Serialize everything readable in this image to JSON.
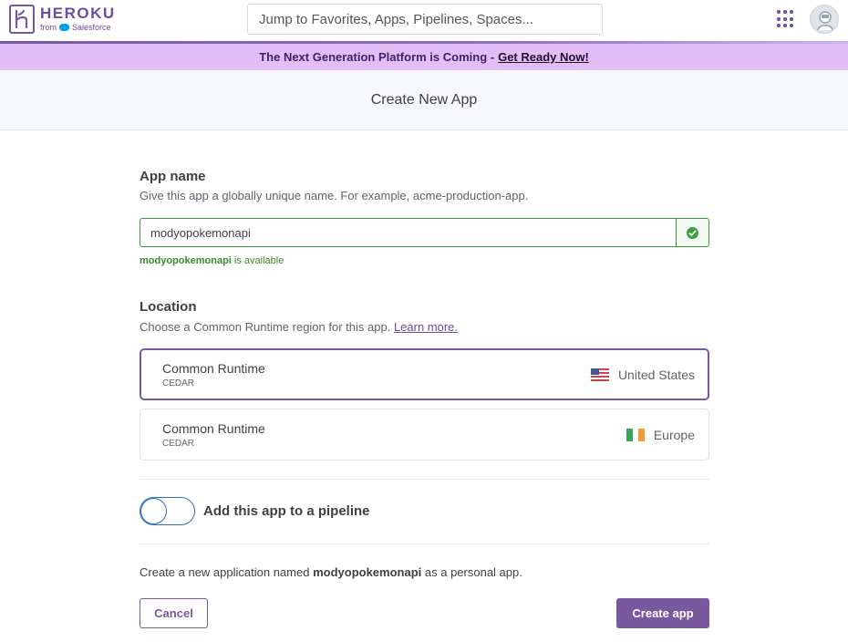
{
  "header": {
    "logo_text": "HEROKU",
    "logo_from": "from",
    "logo_salesforce": "Salesforce",
    "search_placeholder": "Jump to Favorites, Apps, Pipelines, Spaces..."
  },
  "banner": {
    "text": "The Next Generation Platform is Coming -",
    "link": "Get Ready Now!"
  },
  "page_title": "Create New App",
  "app_name": {
    "label": "App name",
    "hint": "Give this app a globally unique name. For example, acme-production-app.",
    "value": "modyopokemonapi",
    "available_name": "modyopokemonapi",
    "available_suffix": "is available"
  },
  "location": {
    "label": "Location",
    "hint": "Choose a Common Runtime region for this app.",
    "learn_more": "Learn more.",
    "regions": [
      {
        "title": "Common Runtime",
        "sub": "CEDAR",
        "place": "United States",
        "selected": true
      },
      {
        "title": "Common Runtime",
        "sub": "CEDAR",
        "place": "Europe",
        "selected": false
      }
    ]
  },
  "pipeline": {
    "label": "Add this app to a pipeline",
    "enabled": false
  },
  "summary": {
    "prefix": "Create a new application named",
    "name": "modyopokemonapi",
    "suffix": "as a personal app."
  },
  "buttons": {
    "cancel": "Cancel",
    "create": "Create app"
  },
  "colors": {
    "brand_purple": "#79589f",
    "banner_bg": "#e3bdf5",
    "success_green": "#3aa143",
    "toggle_blue": "#2d6fb8"
  }
}
